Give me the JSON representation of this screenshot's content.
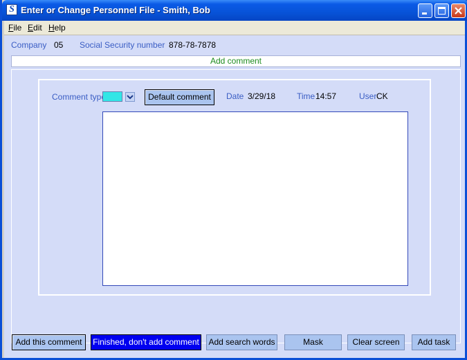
{
  "window": {
    "title": "Enter or Change Personnel File - Smith, Bob"
  },
  "menu": {
    "file": "File",
    "edit": "Edit",
    "help": "Help"
  },
  "header": {
    "company_label": "Company",
    "company_value": "05",
    "ssn_label": "Social Security number",
    "ssn_value": "878-78-7878"
  },
  "section_title": "Add comment",
  "form": {
    "comment_type_label": "Comment type",
    "comment_type_color": "#33e6e6",
    "default_comment_button": "Default comment",
    "date_label": "Date",
    "date_value": "3/29/18",
    "time_label": "Time",
    "time_value": "14:57",
    "user_label": "User",
    "user_value": "CK",
    "comment_text": ""
  },
  "buttons": {
    "add_this_comment": "Add this comment",
    "finished": "Finished, don't add comment",
    "add_search_words": "Add search words",
    "mask": "Mask",
    "clear_screen": "Clear screen",
    "add_task": "Add task"
  },
  "colors": {
    "accent_blue": "#0000f0",
    "label_blue": "#3a5dc4",
    "section_green": "#1d8a1d",
    "title_bar": "#0753d8"
  }
}
